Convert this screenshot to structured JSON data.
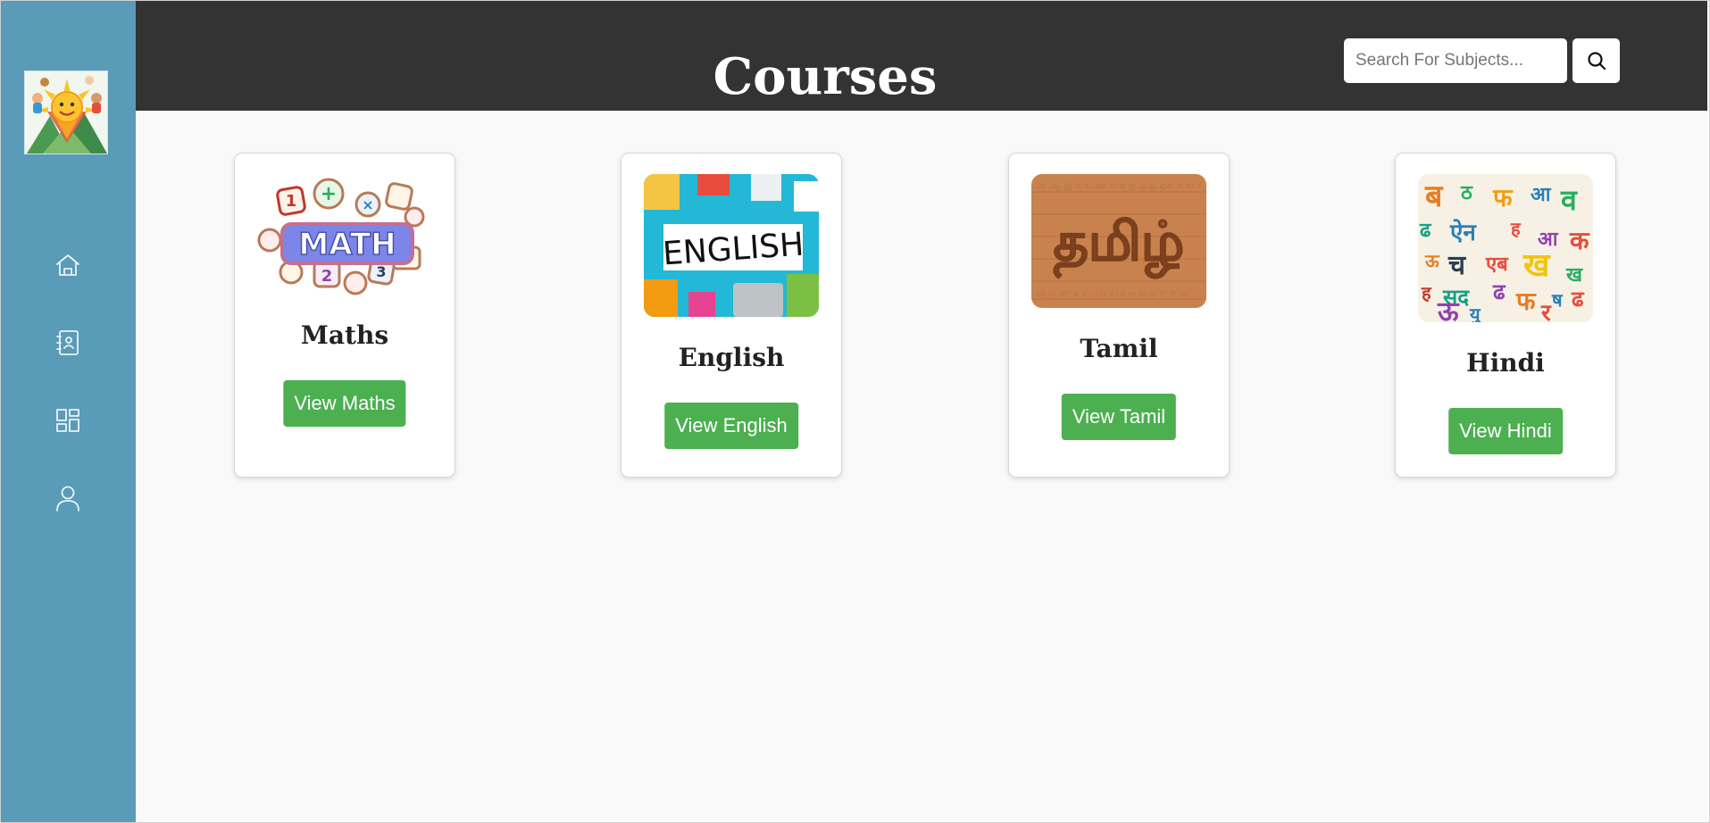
{
  "header": {
    "title": "Courses",
    "search": {
      "placeholder": "Search For Subjects...",
      "value": ""
    },
    "search_button_icon": "search-icon"
  },
  "sidebar": {
    "logo": "app-logo",
    "items": [
      {
        "name": "home",
        "icon": "home-icon"
      },
      {
        "name": "contacts",
        "icon": "contact-card-icon"
      },
      {
        "name": "dashboard",
        "icon": "dashboard-icon"
      },
      {
        "name": "profile",
        "icon": "user-icon"
      }
    ]
  },
  "courses": [
    {
      "title": "Maths",
      "button": "View Maths",
      "image": "math-image"
    },
    {
      "title": "English",
      "button": "View English",
      "image": "english-image"
    },
    {
      "title": "Tamil",
      "button": "View Tamil",
      "image": "tamil-image"
    },
    {
      "title": "Hindi",
      "button": "View Hindi",
      "image": "hindi-image"
    }
  ],
  "colors": {
    "sidebar": "#5a9bb8",
    "header": "#333333",
    "button": "#4caf50",
    "background": "#f9f9f9"
  }
}
